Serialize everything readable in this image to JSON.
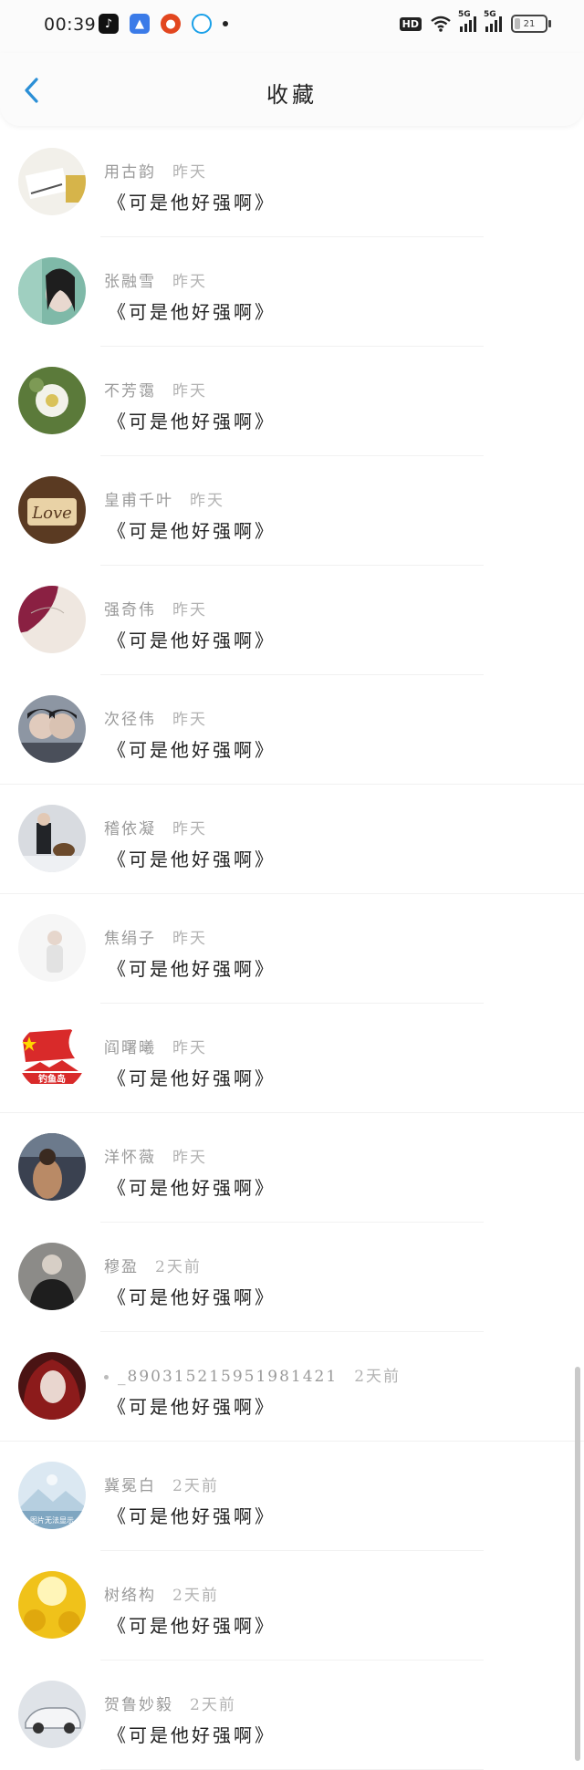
{
  "status_bar": {
    "time": "00:39",
    "hd_label": "HD",
    "net1": "5G",
    "net2": "5G",
    "battery": "21",
    "battery_level": 0.21,
    "app_icons": [
      "tiktok-icon",
      "blue-app-icon",
      "red-app-icon",
      "fish-app-icon"
    ]
  },
  "header": {
    "title": "收藏",
    "back_icon": "chevron-left-icon",
    "accent_color": "#2b8fd6"
  },
  "items": [
    {
      "name": "用古韵",
      "time": "昨天",
      "quote": "《可是他好强啊》",
      "avatar": {
        "type": "stationery",
        "c1": "#f2f0ea",
        "c2": "#d6b44a"
      }
    },
    {
      "name": "张融雪",
      "time": "昨天",
      "quote": "《可是他好强啊》",
      "avatar": {
        "type": "portrait",
        "c1": "#7fb9a8",
        "c2": "#e8d8cf"
      }
    },
    {
      "name": "不芳霭",
      "time": "昨天",
      "quote": "《可是他好强啊》",
      "avatar": {
        "type": "flower",
        "c1": "#5b7a3a",
        "c2": "#f2f2ea"
      }
    },
    {
      "name": "皇甫千叶",
      "time": "昨天",
      "quote": "《可是他好强啊》",
      "avatar": {
        "type": "love",
        "c1": "#5a3a22",
        "c2": "#e9d2a6"
      }
    },
    {
      "name": "强奇伟",
      "time": "昨天",
      "quote": "《可是他好强啊》",
      "avatar": {
        "type": "petal",
        "c1": "#8a2042",
        "c2": "#efe7e0"
      }
    },
    {
      "name": "次径伟",
      "time": "昨天",
      "quote": "《可是他好强啊》",
      "avatar": {
        "type": "couple",
        "c1": "#4a4f5a",
        "c2": "#8d96a3"
      }
    },
    {
      "name": "稽依凝",
      "time": "昨天",
      "quote": "《可是他好强啊》",
      "avatar": {
        "type": "dog",
        "c1": "#d8dbe0",
        "c2": "#222428"
      }
    },
    {
      "name": "焦绢子",
      "time": "昨天",
      "quote": "《可是他好强啊》",
      "avatar": {
        "type": "white",
        "c1": "#f6f6f6",
        "c2": "#e2e2e2"
      }
    },
    {
      "name": "阎曙曦",
      "time": "昨天",
      "quote": "《可是他好强啊》",
      "avatar": {
        "type": "flag",
        "c1": "#d92a2a",
        "c2": "#ffffff",
        "caption": "钓鱼岛"
      }
    },
    {
      "name": "洋怀薇",
      "time": "昨天",
      "quote": "《可是他好强啊》",
      "avatar": {
        "type": "sea",
        "c1": "#3a4150",
        "c2": "#b98a66"
      }
    },
    {
      "name": "穆盈",
      "time": "2天前",
      "quote": "《可是他好强啊》",
      "avatar": {
        "type": "man",
        "c1": "#1e1e1e",
        "c2": "#d7cfc6"
      }
    },
    {
      "name": "_890315215951981421",
      "time": "2天前",
      "quote": "《可是他好强啊》",
      "prefix_dot": true,
      "avatar": {
        "type": "redhair",
        "c1": "#8c1b1b",
        "c2": "#e9d6cf"
      }
    },
    {
      "name": "冀冕白",
      "time": "2天前",
      "quote": "《可是他好强啊》",
      "avatar": {
        "type": "placeholder",
        "c1": "#dbe8f2",
        "c2": "#b6cfe0",
        "caption": "图片无法显示"
      }
    },
    {
      "name": "树络构",
      "time": "2天前",
      "quote": "《可是他好强啊》",
      "avatar": {
        "type": "sunflower",
        "c1": "#f0c21a",
        "c2": "#fff5b8"
      }
    },
    {
      "name": "贺鲁妙毅",
      "time": "2天前",
      "quote": "《可是他好强啊》",
      "avatar": {
        "type": "car",
        "c1": "#dfe3e8",
        "c2": "#8b929b"
      }
    }
  ]
}
